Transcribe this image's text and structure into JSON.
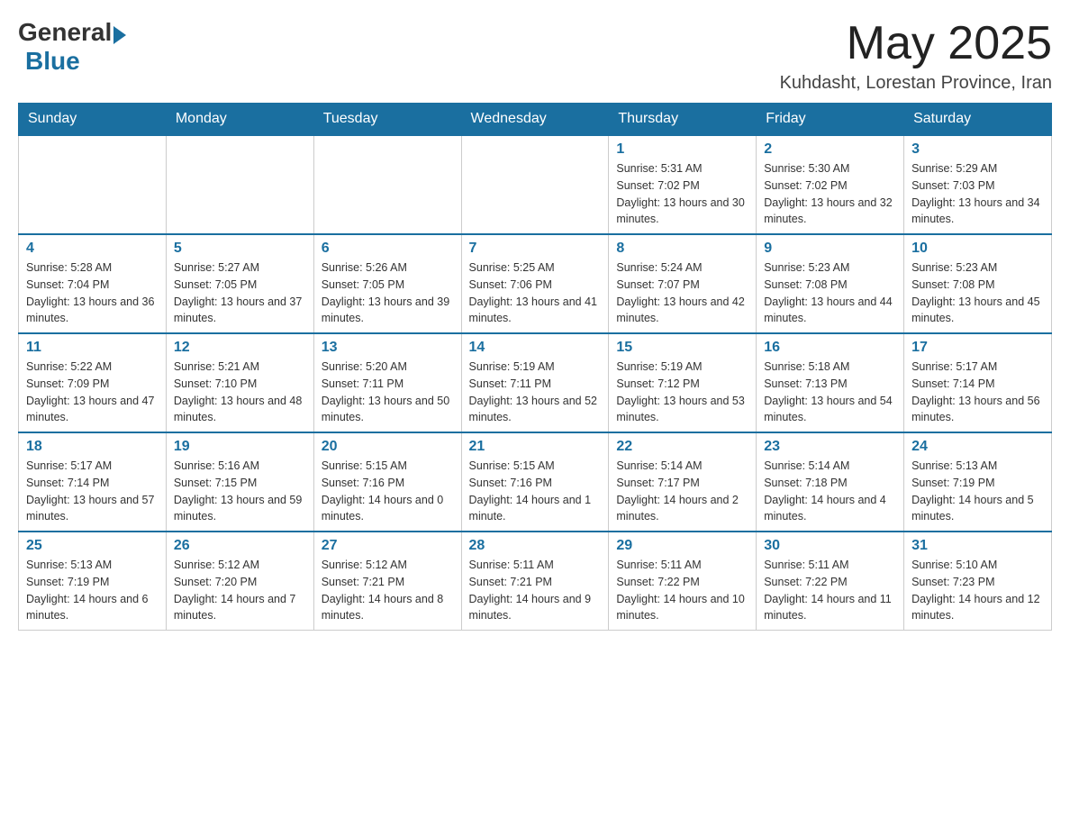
{
  "header": {
    "logo_general": "General",
    "logo_blue": "Blue",
    "month_title": "May 2025",
    "location": "Kuhdasht, Lorestan Province, Iran"
  },
  "days_of_week": [
    "Sunday",
    "Monday",
    "Tuesday",
    "Wednesday",
    "Thursday",
    "Friday",
    "Saturday"
  ],
  "weeks": [
    {
      "days": [
        {
          "number": "",
          "info": ""
        },
        {
          "number": "",
          "info": ""
        },
        {
          "number": "",
          "info": ""
        },
        {
          "number": "",
          "info": ""
        },
        {
          "number": "1",
          "info": "Sunrise: 5:31 AM\nSunset: 7:02 PM\nDaylight: 13 hours and 30 minutes."
        },
        {
          "number": "2",
          "info": "Sunrise: 5:30 AM\nSunset: 7:02 PM\nDaylight: 13 hours and 32 minutes."
        },
        {
          "number": "3",
          "info": "Sunrise: 5:29 AM\nSunset: 7:03 PM\nDaylight: 13 hours and 34 minutes."
        }
      ]
    },
    {
      "days": [
        {
          "number": "4",
          "info": "Sunrise: 5:28 AM\nSunset: 7:04 PM\nDaylight: 13 hours and 36 minutes."
        },
        {
          "number": "5",
          "info": "Sunrise: 5:27 AM\nSunset: 7:05 PM\nDaylight: 13 hours and 37 minutes."
        },
        {
          "number": "6",
          "info": "Sunrise: 5:26 AM\nSunset: 7:05 PM\nDaylight: 13 hours and 39 minutes."
        },
        {
          "number": "7",
          "info": "Sunrise: 5:25 AM\nSunset: 7:06 PM\nDaylight: 13 hours and 41 minutes."
        },
        {
          "number": "8",
          "info": "Sunrise: 5:24 AM\nSunset: 7:07 PM\nDaylight: 13 hours and 42 minutes."
        },
        {
          "number": "9",
          "info": "Sunrise: 5:23 AM\nSunset: 7:08 PM\nDaylight: 13 hours and 44 minutes."
        },
        {
          "number": "10",
          "info": "Sunrise: 5:23 AM\nSunset: 7:08 PM\nDaylight: 13 hours and 45 minutes."
        }
      ]
    },
    {
      "days": [
        {
          "number": "11",
          "info": "Sunrise: 5:22 AM\nSunset: 7:09 PM\nDaylight: 13 hours and 47 minutes."
        },
        {
          "number": "12",
          "info": "Sunrise: 5:21 AM\nSunset: 7:10 PM\nDaylight: 13 hours and 48 minutes."
        },
        {
          "number": "13",
          "info": "Sunrise: 5:20 AM\nSunset: 7:11 PM\nDaylight: 13 hours and 50 minutes."
        },
        {
          "number": "14",
          "info": "Sunrise: 5:19 AM\nSunset: 7:11 PM\nDaylight: 13 hours and 52 minutes."
        },
        {
          "number": "15",
          "info": "Sunrise: 5:19 AM\nSunset: 7:12 PM\nDaylight: 13 hours and 53 minutes."
        },
        {
          "number": "16",
          "info": "Sunrise: 5:18 AM\nSunset: 7:13 PM\nDaylight: 13 hours and 54 minutes."
        },
        {
          "number": "17",
          "info": "Sunrise: 5:17 AM\nSunset: 7:14 PM\nDaylight: 13 hours and 56 minutes."
        }
      ]
    },
    {
      "days": [
        {
          "number": "18",
          "info": "Sunrise: 5:17 AM\nSunset: 7:14 PM\nDaylight: 13 hours and 57 minutes."
        },
        {
          "number": "19",
          "info": "Sunrise: 5:16 AM\nSunset: 7:15 PM\nDaylight: 13 hours and 59 minutes."
        },
        {
          "number": "20",
          "info": "Sunrise: 5:15 AM\nSunset: 7:16 PM\nDaylight: 14 hours and 0 minutes."
        },
        {
          "number": "21",
          "info": "Sunrise: 5:15 AM\nSunset: 7:16 PM\nDaylight: 14 hours and 1 minute."
        },
        {
          "number": "22",
          "info": "Sunrise: 5:14 AM\nSunset: 7:17 PM\nDaylight: 14 hours and 2 minutes."
        },
        {
          "number": "23",
          "info": "Sunrise: 5:14 AM\nSunset: 7:18 PM\nDaylight: 14 hours and 4 minutes."
        },
        {
          "number": "24",
          "info": "Sunrise: 5:13 AM\nSunset: 7:19 PM\nDaylight: 14 hours and 5 minutes."
        }
      ]
    },
    {
      "days": [
        {
          "number": "25",
          "info": "Sunrise: 5:13 AM\nSunset: 7:19 PM\nDaylight: 14 hours and 6 minutes."
        },
        {
          "number": "26",
          "info": "Sunrise: 5:12 AM\nSunset: 7:20 PM\nDaylight: 14 hours and 7 minutes."
        },
        {
          "number": "27",
          "info": "Sunrise: 5:12 AM\nSunset: 7:21 PM\nDaylight: 14 hours and 8 minutes."
        },
        {
          "number": "28",
          "info": "Sunrise: 5:11 AM\nSunset: 7:21 PM\nDaylight: 14 hours and 9 minutes."
        },
        {
          "number": "29",
          "info": "Sunrise: 5:11 AM\nSunset: 7:22 PM\nDaylight: 14 hours and 10 minutes."
        },
        {
          "number": "30",
          "info": "Sunrise: 5:11 AM\nSunset: 7:22 PM\nDaylight: 14 hours and 11 minutes."
        },
        {
          "number": "31",
          "info": "Sunrise: 5:10 AM\nSunset: 7:23 PM\nDaylight: 14 hours and 12 minutes."
        }
      ]
    }
  ]
}
